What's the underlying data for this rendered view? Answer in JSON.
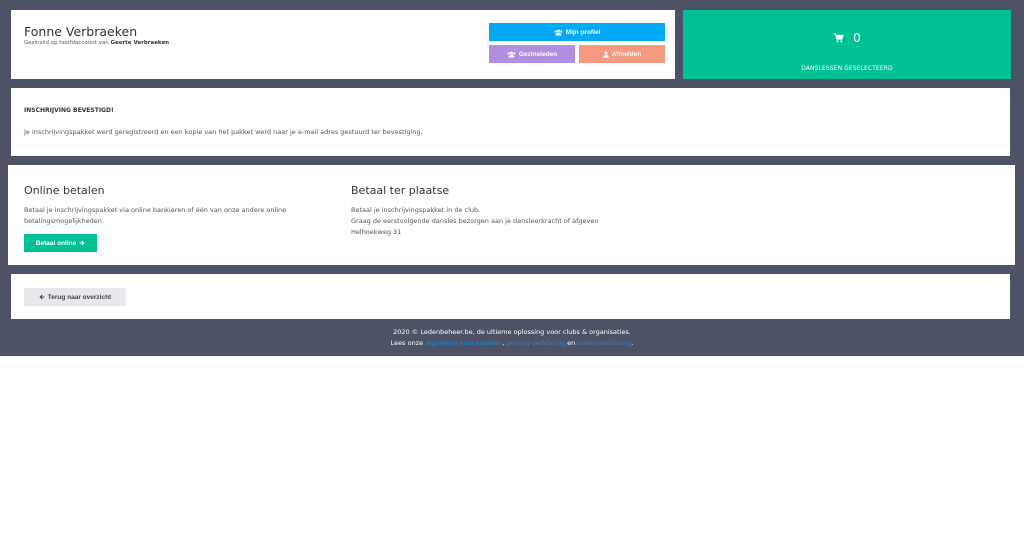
{
  "profile": {
    "name": "Fonne Verbraeken",
    "sub_prefix": "Gezinslid op hoofdaccount van",
    "sub_owner": "Geerte Verbraeken",
    "btn_profile": "Mijn profiel",
    "btn_family": "Gezinsleden",
    "btn_logout": "Afmelden"
  },
  "cart": {
    "count": "0",
    "label": "DANSLESSEN GESELECTEERD"
  },
  "confirmation": {
    "title": "INSCHRIJVING BEVESTIGD!",
    "text": "Je inschrijvingspakket werd geregistreerd en een kopie van het pakket werd naar je e-mail adres gestuurd ter bevestiging."
  },
  "payment": {
    "online": {
      "title": "Online betalen",
      "text": "Betaal je inschrijvingspakket via online bankieren of één van onze andere online betalingsmogelijkheden.",
      "button": "Betaal online"
    },
    "local": {
      "title": "Betaal ter plaatse",
      "line1": "Betaal je inschrijvingspakket in de club.",
      "line2": "Graag de eerstvolgende dansles bezorgen aan je dansleerkracht of afgeven",
      "line3": "Helhoekweg 31"
    }
  },
  "back": {
    "button": "Terug naar overzicht"
  },
  "footer": {
    "line1": "2020 © Ledenbeheer.be, de ultieme oplossing voor clubs & organisaties.",
    "read_prefix": "Lees onze",
    "link1": "algemene voorwaarden",
    "sep1": ",",
    "link2": "privacy verklaring",
    "and": "en",
    "link3": "cookieverklaring",
    "end": "."
  },
  "colors": {
    "background": "#4e5266",
    "accent_green": "#00c195",
    "accent_blue": "#03a9f4",
    "family_purple": "#b18ee0",
    "logout_salmon": "#f49a82",
    "link_blue": "#1e88d6"
  },
  "icons": {
    "profile": "users-icon",
    "family": "users-icon",
    "logout": "user-icon",
    "cart": "shopping-cart-icon",
    "pay": "arrow-right-icon",
    "back": "arrow-left-icon"
  }
}
